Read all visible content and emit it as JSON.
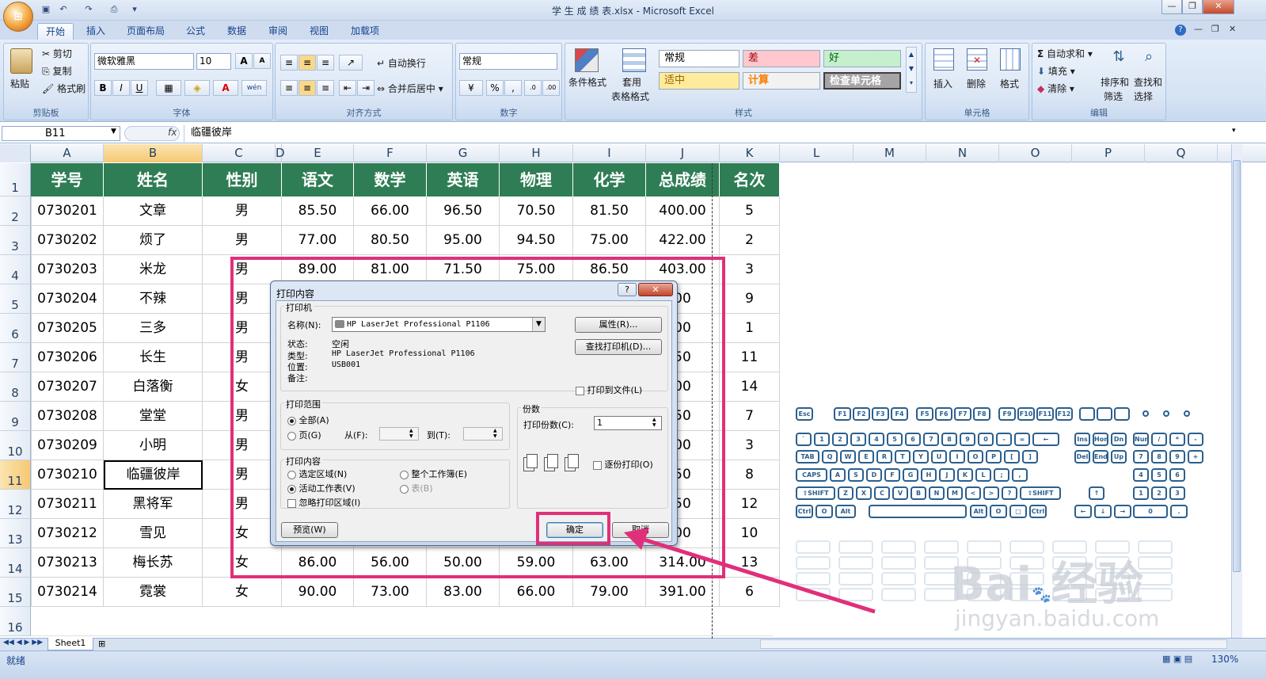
{
  "window": {
    "title": "学 生 成 绩 表.xlsx - Microsoft Excel"
  },
  "tabs": [
    "开始",
    "插入",
    "页面布局",
    "公式",
    "数据",
    "审阅",
    "视图",
    "加载项"
  ],
  "ribbon": {
    "clipboard": {
      "label": "剪贴板",
      "paste": "粘贴",
      "cut": "剪切",
      "copy": "复制",
      "format_painter": "格式刷"
    },
    "font": {
      "label": "字体",
      "name": "微软雅黑",
      "size": "10",
      "bold": "B",
      "italic": "I",
      "underline": "U",
      "grow": "A",
      "shrink": "A",
      "fontcolor": "A",
      "phonetic": "wén"
    },
    "alignment": {
      "label": "对齐方式",
      "wrap": "自动换行",
      "merge": "合并后居中"
    },
    "number": {
      "label": "数字",
      "format": "常规",
      "percent": "%",
      "comma": ","
    },
    "styles": {
      "label": "样式",
      "conditional": "条件格式",
      "as_table_1": "套用",
      "as_table_2": "表格格式",
      "cells": [
        "常规",
        "差",
        "好",
        "适中",
        "计算",
        "检查单元格"
      ]
    },
    "cells": {
      "label": "单元格",
      "insert": "插入",
      "delete": "删除",
      "format": "格式"
    },
    "editing": {
      "label": "编辑",
      "autosum": "自动求和",
      "fill": "填充",
      "clear": "清除",
      "sort_1": "排序和",
      "sort_2": "筛选",
      "find_1": "查找和",
      "find_2": "选择"
    }
  },
  "formula_bar": {
    "name_box": "B11",
    "fx": "fx",
    "content": "临疆彼岸"
  },
  "columns": [
    "A",
    "B",
    "C",
    "D",
    "E",
    "F",
    "G",
    "H",
    "I",
    "J",
    "K",
    "L",
    "M",
    "N",
    "O",
    "P",
    "Q"
  ],
  "rows": [
    "1",
    "2",
    "3",
    "4",
    "5",
    "6",
    "7",
    "8",
    "9",
    "10",
    "11",
    "12",
    "13",
    "14",
    "15",
    "16"
  ],
  "table": {
    "headers": [
      "学号",
      "姓名",
      "性别",
      "语文",
      "数学",
      "英语",
      "物理",
      "化学",
      "总成绩",
      "名次"
    ],
    "rows": [
      [
        "0730201",
        "文章",
        "男",
        "85.50",
        "66.00",
        "96.50",
        "70.50",
        "81.50",
        "400.00",
        "5"
      ],
      [
        "0730202",
        "烦了",
        "男",
        "77.00",
        "80.50",
        "95.00",
        "94.50",
        "75.00",
        "422.00",
        "2"
      ],
      [
        "0730203",
        "米龙",
        "男",
        "89.00",
        "81.00",
        "71.50",
        "75.00",
        "86.50",
        "403.00",
        "3"
      ],
      [
        "0730204",
        "不辣",
        "男",
        "",
        "",
        "",
        "",
        "",
        "00",
        "9"
      ],
      [
        "0730205",
        "三多",
        "男",
        "",
        "",
        "",
        "",
        "",
        "00",
        "1"
      ],
      [
        "0730206",
        "长生",
        "男",
        "",
        "",
        "",
        "",
        "",
        "50",
        "11"
      ],
      [
        "0730207",
        "白落衡",
        "女",
        "",
        "",
        "",
        "",
        "",
        "00",
        "14"
      ],
      [
        "0730208",
        "堂堂",
        "男",
        "",
        "",
        "",
        "",
        "",
        "50",
        "7"
      ],
      [
        "0730209",
        "小明",
        "男",
        "",
        "",
        "",
        "",
        "",
        "00",
        "3"
      ],
      [
        "0730210",
        "临疆彼岸",
        "男",
        "",
        "",
        "",
        "",
        "",
        "50",
        "8"
      ],
      [
        "0730211",
        "黑将军",
        "男",
        "",
        "",
        "",
        "",
        "",
        "50",
        "12"
      ],
      [
        "0730212",
        "雪见",
        "女",
        "",
        "",
        "",
        "",
        "",
        "00",
        "10"
      ],
      [
        "0730213",
        "梅长苏",
        "女",
        "86.00",
        "56.00",
        "50.00",
        "59.00",
        "63.00",
        "314.00",
        "13"
      ],
      [
        "0730214",
        "霓裳",
        "女",
        "90.00",
        "73.00",
        "83.00",
        "66.00",
        "79.00",
        "391.00",
        "6"
      ]
    ]
  },
  "dialog": {
    "title": "打印内容",
    "help": "?",
    "close": "✕",
    "printer_section": "打印机",
    "name_label": "名称(N):",
    "printer_name": "HP LaserJet Professional P1106",
    "properties_btn": "属性(R)...",
    "find_printer_btn": "查找打印机(D)...",
    "status_label": "状态:",
    "status_value": "空闲",
    "type_label": "类型:",
    "type_value": "HP LaserJet Professional P1106",
    "location_label": "位置:",
    "location_value": "USB001",
    "comment_label": "备注:",
    "print_to_file": "打印到文件(L)",
    "range_section": "打印范围",
    "range_all": "全部(A)",
    "range_pages": "页(G)",
    "from_label": "从(F):",
    "to_label": "到(T):",
    "copies_section": "份数",
    "copies_label": "打印份数(C):",
    "copies_value": "1",
    "collate": "逐份打印(O)",
    "what_section": "打印内容",
    "what_selection": "选定区域(N)",
    "what_workbook": "整个工作簿(E)",
    "what_active": "活动工作表(V)",
    "what_table": "表(B)",
    "ignore_area": "忽略打印区域(I)",
    "preview_btn": "预览(W)",
    "ok_btn": "确定",
    "cancel_btn": "取消"
  },
  "keyboard": {
    "row0": [
      "Esc",
      "F1",
      "F2",
      "F3",
      "F4",
      "F5",
      "F6",
      "F7",
      "F8",
      "F9",
      "F10",
      "F11",
      "F12"
    ],
    "row1": [
      "`",
      "1",
      "2",
      "3",
      "4",
      "5",
      "6",
      "7",
      "8",
      "9",
      "0",
      "-",
      "=",
      "←",
      "Ins",
      "Hom",
      "Dn",
      "Num",
      "/",
      "*",
      "-"
    ],
    "row2": [
      "TAB",
      "Q",
      "W",
      "E",
      "R",
      "T",
      "Y",
      "U",
      "I",
      "O",
      "P",
      "[",
      "]",
      "Del",
      "End",
      "Up",
      "7",
      "8",
      "9",
      "+"
    ],
    "row3": [
      "CAPS",
      "A",
      "S",
      "D",
      "F",
      "G",
      "H",
      "J",
      "K",
      "L",
      ";",
      ",",
      "4",
      "5",
      "6"
    ],
    "row4": [
      "⇧SHIFT",
      "Z",
      "X",
      "C",
      "V",
      "B",
      "N",
      "M",
      "<",
      ">",
      "?",
      "⇧SHIFT",
      "↑",
      "1",
      "2",
      "3"
    ],
    "row5": [
      "Ctrl",
      "O",
      "Alt",
      "Alt",
      "O",
      "□",
      "Ctrl",
      "←",
      "↓",
      "→",
      "0",
      "."
    ]
  },
  "watermark": {
    "brand": "Bai",
    "brand2": "经验",
    "url": "jingyan.baidu.com"
  },
  "sheet_tab": "Sheet1",
  "status": {
    "ready": "就绪",
    "zoom": "130%"
  },
  "colors": {
    "header_green": "#2e7d55",
    "highlight_pink": "#e0307a",
    "ribbon_bg": "#d6e3f4"
  }
}
